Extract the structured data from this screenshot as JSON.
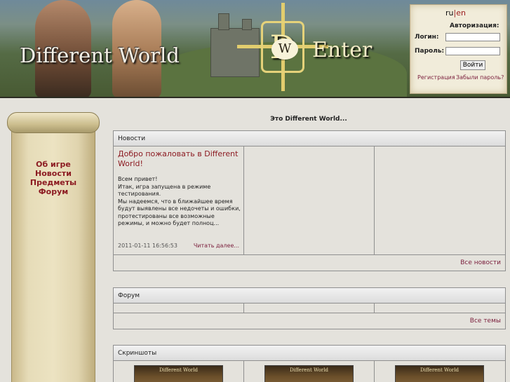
{
  "header": {
    "logo_text": "Different World",
    "emblem_letter": "D",
    "emblem_inner": "W",
    "enter_text": "Enter"
  },
  "login": {
    "lang_ru": "ru",
    "lang_sep": "|",
    "lang_en": "en",
    "title": "Авторизация:",
    "login_label": "Логин:",
    "password_label": "Пароль:",
    "login_value": "",
    "password_value": "",
    "button": "Войти",
    "register_link": "Регистрация",
    "forgot_link": "Забыли пароль?"
  },
  "menu": {
    "items": [
      "Об игре",
      "Новости",
      "Предметы",
      "Форум"
    ]
  },
  "main": {
    "title": "Это Different World..."
  },
  "news": {
    "header": "Новости",
    "item_title": "Добро пожаловать в Different World!",
    "item_body": "Всем привет!\nИтак, игра запущена в режиме тестирования.\nМы надеемся, что в ближайшее время будут выявлены все недочеты и ошибки, протестированы все возможные режимы, и можно будет полноц...",
    "item_date": "2011-01-11 16:56:53",
    "read_more": "Читать далее...",
    "all_link": "Все новости"
  },
  "forum": {
    "header": "Форум",
    "all_link": "Все темы"
  },
  "screenshots": {
    "header": "Скриншоты",
    "thumb_caption": "Different World"
  }
}
